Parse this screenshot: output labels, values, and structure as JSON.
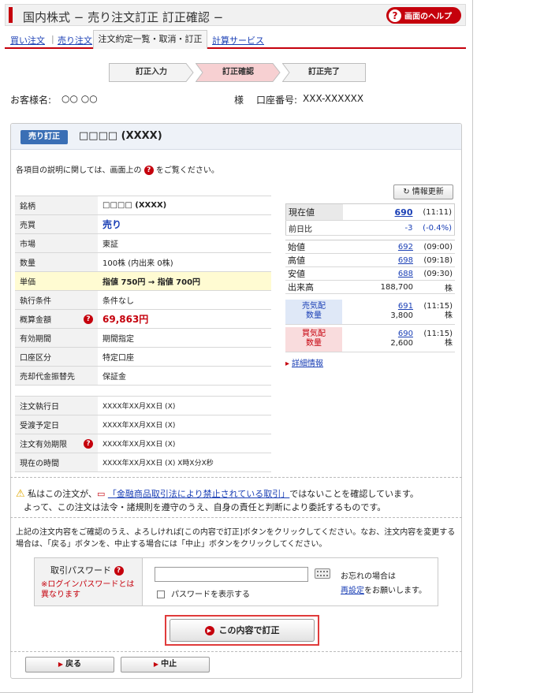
{
  "header": {
    "title": "国内株式 − 売り注文訂正 訂正確認 −",
    "help_label": "画面のヘルプ"
  },
  "tabs": {
    "buy": "買い注文",
    "sell": "売り注文",
    "active": "注文約定一覧・取消・訂正",
    "calc": "計算サービス"
  },
  "steps": [
    "訂正入力",
    "訂正確認",
    "訂正完了"
  ],
  "customer": {
    "name_label": "お客様名:",
    "name_value": "○○ ○○",
    "honorific": "様",
    "account_label": "口座番号:",
    "account_value": "XXX-XXXXXX"
  },
  "panel": {
    "badge": "売り訂正",
    "product": "□□□□ (XXXX)"
  },
  "note": {
    "before": "各項目の説明に関しては、画面上の",
    "after": "をご覧ください。"
  },
  "order_table": [
    {
      "label": "銘柄",
      "value": "□□□□ (XXXX)"
    },
    {
      "label": "売買",
      "value": "売り"
    },
    {
      "label": "市場",
      "value": "東証"
    },
    {
      "label": "数量",
      "value": "100株 (内出来 0株)"
    },
    {
      "label": "単価",
      "value": "指値 750円 → 指値 700円"
    },
    {
      "label": "執行条件",
      "value": "条件なし"
    },
    {
      "label": "概算金額",
      "value": "69,863円"
    },
    {
      "label": "有効期間",
      "value": "期間指定"
    },
    {
      "label": "口座区分",
      "value": "特定口座"
    },
    {
      "label": "売却代金振替先",
      "value": "保証金"
    }
  ],
  "date_table": [
    {
      "label": "注文執行日",
      "value": "XXXX年XX月XX日 (X)"
    },
    {
      "label": "受渡予定日",
      "value": "XXXX年XX月XX日 (X)"
    },
    {
      "label": "注文有効期限",
      "value": "XXXX年XX月XX日 (X)"
    },
    {
      "label": "現在の時間",
      "value": "XXXX年XX月XX日 (X) X時X分X秒"
    }
  ],
  "quote": {
    "refresh": "情報更新",
    "current": {
      "label": "現在値",
      "value": "690",
      "time": "(11:11)"
    },
    "change": {
      "label": "前日比",
      "value": "-3",
      "pct": "(-0.4%)"
    },
    "open": {
      "label": "始値",
      "value": "692",
      "time": "(09:00)"
    },
    "high": {
      "label": "高値",
      "value": "698",
      "time": "(09:18)"
    },
    "low": {
      "label": "安値",
      "value": "688",
      "time": "(09:30)"
    },
    "volume": {
      "label": "出来高",
      "value": "188,700",
      "unit": "株"
    },
    "ask": {
      "label1": "売気配",
      "label2": "数量",
      "price": "691",
      "qty": "3,800",
      "time": "(11:15)",
      "unit": "株"
    },
    "bid": {
      "label1": "買気配",
      "label2": "数量",
      "price": "690",
      "qty": "2,600",
      "time": "(11:15)",
      "unit": "株"
    },
    "detail": "詳細情報"
  },
  "warning": {
    "pre": "私はこの注文が、",
    "link": "「金融商品取引法により禁止されている取引」",
    "post": "ではないことを確認しています。",
    "line2": "よって、この注文は法令・諸規則を遵守のうえ、自身の責任と判断により委託するものです。"
  },
  "instructions": "上記の注文内容をご確認のうえ、よろしければ[この内容で訂正]ボタンをクリックしてください。なお、注文内容を変更する場合は、「戻る」ボタンを、中止する場合には「中止」ボタンをクリックしてください。",
  "password": {
    "label": "取引パスワード",
    "sub": "※ログインパスワードとは異なります",
    "show": "パスワードを表示する",
    "forgot1": "お忘れの場合は",
    "forgot_link": "再設定",
    "forgot2": "をお願いします。"
  },
  "buttons": {
    "submit": "この内容で訂正",
    "back": "戻る",
    "cancel": "中止"
  },
  "colors": {
    "brand_red": "#c5000c",
    "link_blue": "#1a3fb5",
    "highlight_yellow": "#fffbd2"
  }
}
